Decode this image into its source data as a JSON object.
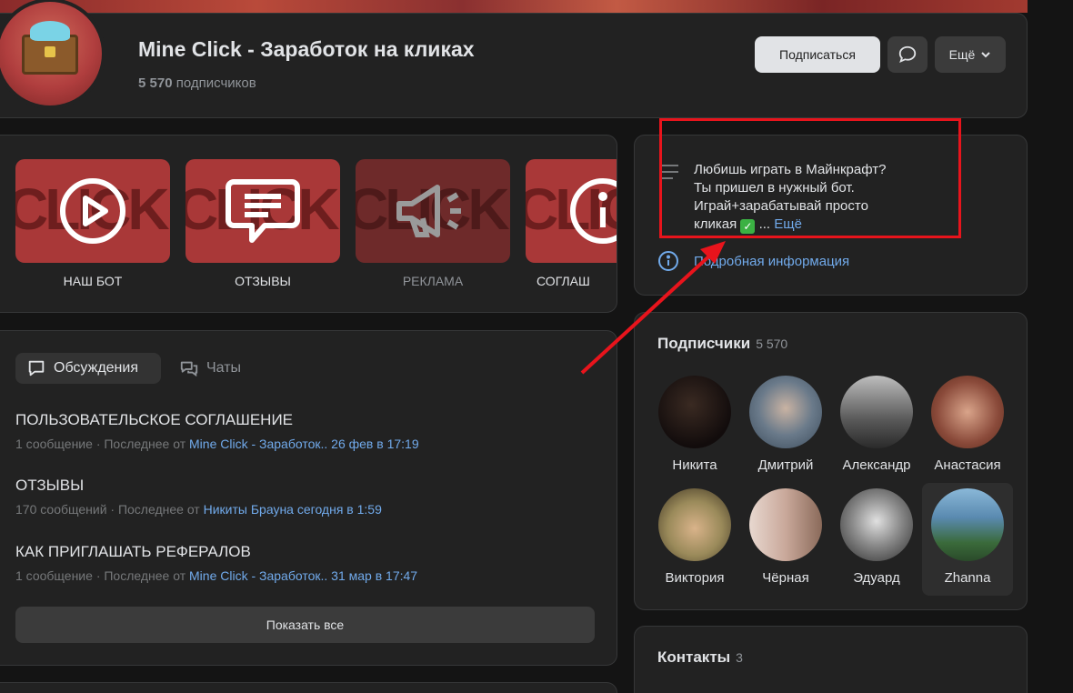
{
  "header": {
    "title": "Mine Click - Заработок на кликах",
    "subscribers_count": "5 570",
    "subscribers_label": "подписчиков",
    "subscribe_button": "Подписаться",
    "more_button": "Ещё"
  },
  "links": [
    {
      "label": "НАШ БОТ",
      "icon": "play-icon"
    },
    {
      "label": "ОТЗЫВЫ",
      "icon": "message-icon"
    },
    {
      "label": "РЕКЛАМА",
      "icon": "megaphone-icon"
    },
    {
      "label": "СОГЛАШ",
      "icon": "info-icon"
    }
  ],
  "discussions": {
    "tab_active": "Обсуждения",
    "tab_chats": "Чаты",
    "topics": [
      {
        "title": "ПОЛЬЗОВАТЕЛЬСКОЕ СОГЛАШЕНИЕ",
        "count": "1 сообщение",
        "last_prefix": "· Последнее от",
        "last_link": "Mine Click - Заработок.. 26 фев в 17:19"
      },
      {
        "title": "ОТЗЫВЫ",
        "count": "170 сообщений",
        "last_prefix": "· Последнее от",
        "last_link": "Никиты Брауна сегодня в 1:59"
      },
      {
        "title": "КАК ПРИГЛАШАТЬ РЕФЕРАЛОВ",
        "count": "1 сообщение",
        "last_prefix": "· Последнее от",
        "last_link": "Mine Click - Заработок.. 31 мар в 17:47"
      }
    ],
    "show_all": "Показать все"
  },
  "about": {
    "line1": "Любишь играть в Майнкрафт?",
    "line2": "Ты пришел в нужный бот.",
    "line3": "Играй+зарабатывай просто",
    "line4": "кликая",
    "ellipsis": "...",
    "more": "Ещё",
    "details": "Подробная информация"
  },
  "subscribers": {
    "title": "Подписчики",
    "count": "5 570",
    "members": [
      {
        "name": "Никита",
        "color": "#1a1414"
      },
      {
        "name": "Дмитрий",
        "color": "#5a6a7a"
      },
      {
        "name": "Александр",
        "color": "#6b6b6b"
      },
      {
        "name": "Анастасия",
        "color": "#8a4a3a"
      },
      {
        "name": "Виктория",
        "color": "#9a8a5a"
      },
      {
        "name": "Чёрная",
        "color": "#c9a89a"
      },
      {
        "name": "Эдуард",
        "color": "#4a4a4a"
      },
      {
        "name": "Zhanna",
        "color": "#5a8ab0"
      }
    ]
  },
  "contacts": {
    "title": "Контакты",
    "count": "3"
  },
  "colors": {
    "accent_link": "#71aaeb",
    "annotation_red": "#e8141c"
  }
}
